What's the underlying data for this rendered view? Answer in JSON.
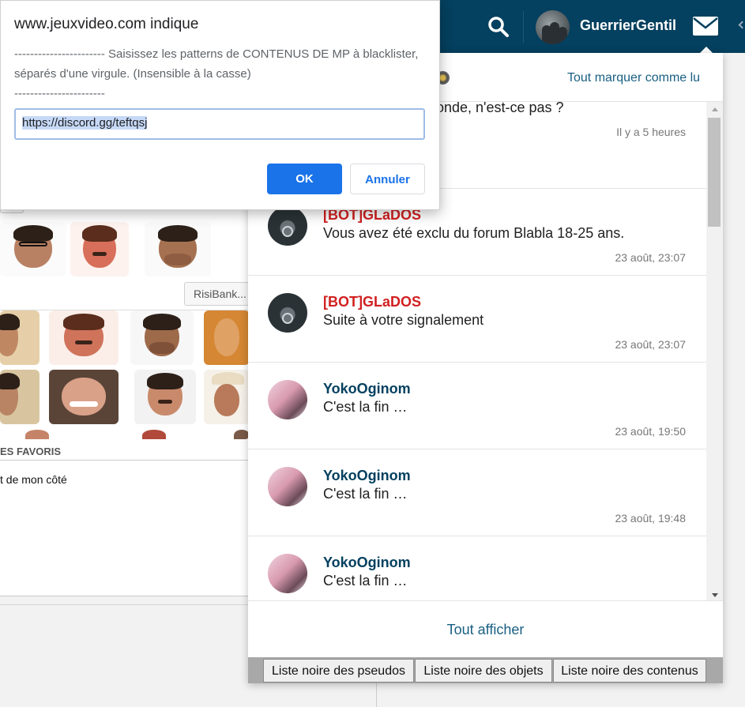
{
  "header": {
    "username": "GuerrierGentil",
    "icons": {
      "search": "search-icon",
      "mail": "mail-icon"
    }
  },
  "background_page": {
    "risibank_button": "RisiBank...",
    "favoris_label": "ES FAVORIS",
    "favori_text": "t de mon côté"
  },
  "dialog": {
    "title": "www.jeuxvideo.com indique",
    "message": "----------------------- Saisissez les patterns de CONTENUS DE MP à blacklister, séparés d'une virgule. (Insensible à la casse)\n-----------------------",
    "input_value": "https://discord.gg/teftqsj",
    "ok_label": "OK",
    "cancel_label": "Annuler"
  },
  "panel": {
    "mark_all_label": "Tout marquer comme lu",
    "show_all_label": "Tout afficher",
    "messages": [
      {
        "author": "",
        "text": "monde, n'est-ce pas ?",
        "date": "Il y a 5 heures",
        "type": "user"
      },
      {
        "author": "[BOT]GLaDOS",
        "text": "Vous avez été exclu du forum Blabla 18-25 ans.",
        "date": "23 août, 23:07",
        "type": "bot"
      },
      {
        "author": "[BOT]GLaDOS",
        "text": "Suite à votre signalement",
        "date": "23 août, 23:07",
        "type": "bot"
      },
      {
        "author": "YokoOginom",
        "text": "C'est la fin …",
        "date": "23 août, 19:50",
        "type": "user"
      },
      {
        "author": "YokoOginom",
        "text": "C'est la fin …",
        "date": "23 août, 19:48",
        "type": "user"
      },
      {
        "author": "YokoOginom",
        "text": "C'est la fin …",
        "date": "",
        "type": "user"
      }
    ],
    "blacklist_buttons": [
      "Liste noire des pseudos",
      "Liste noire des objets",
      "Liste noire des contenus"
    ]
  },
  "colors": {
    "header_bg": "#04405f",
    "bot_author": "#d12020",
    "user_author": "#04405f",
    "link": "#195f83",
    "dialog_ok": "#1a73e8"
  }
}
